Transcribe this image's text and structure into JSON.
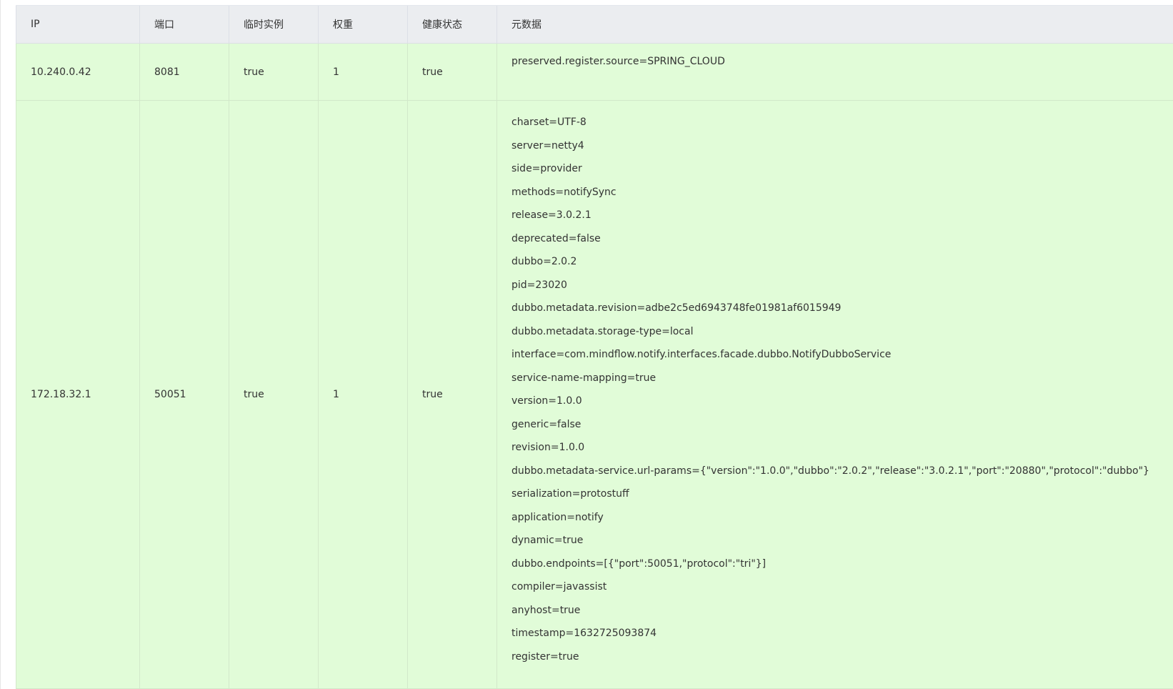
{
  "table": {
    "headers": {
      "ip": "IP",
      "port": "端口",
      "ephemeral": "临时实例",
      "weight": "权重",
      "healthy": "健康状态",
      "metadata": "元数据"
    },
    "rows": [
      {
        "ip": "10.240.0.42",
        "port": "8081",
        "ephemeral": "true",
        "weight": "1",
        "healthy": "true",
        "metadata": [
          "preserved.register.source=SPRING_CLOUD"
        ]
      },
      {
        "ip": "172.18.32.1",
        "port": "50051",
        "ephemeral": "true",
        "weight": "1",
        "healthy": "true",
        "metadata": [
          "charset=UTF-8",
          "server=netty4",
          "side=provider",
          "methods=notifySync",
          "release=3.0.2.1",
          "deprecated=false",
          "dubbo=2.0.2",
          "pid=23020",
          "dubbo.metadata.revision=adbe2c5ed6943748fe01981af6015949",
          "dubbo.metadata.storage-type=local",
          "interface=com.mindflow.notify.interfaces.facade.dubbo.NotifyDubboService",
          "service-name-mapping=true",
          "version=1.0.0",
          "generic=false",
          "revision=1.0.0",
          "dubbo.metadata-service.url-params={\"version\":\"1.0.0\",\"dubbo\":\"2.0.2\",\"release\":\"3.0.2.1\",\"port\":\"20880\",\"protocol\":\"dubbo\"}",
          "serialization=protostuff",
          "application=notify",
          "dynamic=true",
          "dubbo.endpoints=[{\"port\":50051,\"protocol\":\"tri\"}]",
          "compiler=javassist",
          "anyhost=true",
          "timestamp=1632725093874",
          "register=true"
        ]
      }
    ]
  },
  "colors": {
    "header_bg": "#ebedf0",
    "healthy_row_bg": "#e1fcd8",
    "text": "#333333"
  }
}
